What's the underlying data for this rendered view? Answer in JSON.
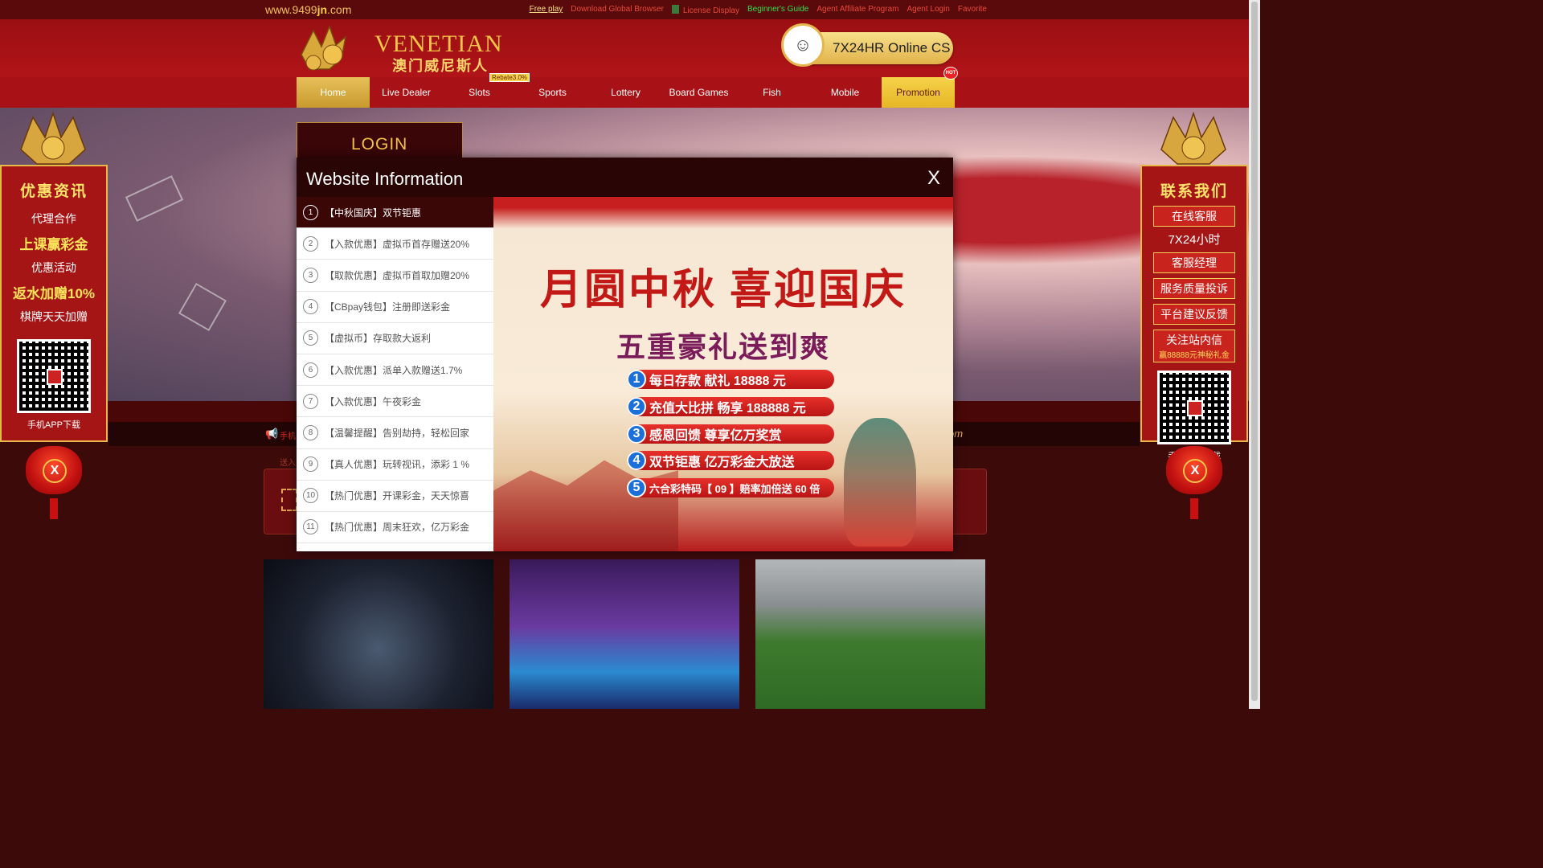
{
  "site": {
    "url_prefix": "www.9499",
    "url_bold": "jn",
    "url_suffix": ".com"
  },
  "top_links": [
    {
      "label": "Free play",
      "color": "#f6e38a"
    },
    {
      "label": "Download Global Browser",
      "color": "#e84a3a"
    },
    {
      "label": "License Display",
      "color": "#e84a3a"
    },
    {
      "label": "Beginner's Guide",
      "color": "#2ee04a"
    },
    {
      "label": "Agent Affiliate Program",
      "color": "#e84a3a"
    },
    {
      "label": "Agent Login",
      "color": "#e84a3a"
    },
    {
      "label": "Favorite",
      "color": "#e84a3a"
    }
  ],
  "logo": {
    "name": "VENETIAN",
    "subtitle": "澳门威尼斯人"
  },
  "cs": {
    "label": "7X24HR Online CS"
  },
  "nav": {
    "items": [
      "Home",
      "Live Dealer",
      "Slots",
      "Sports",
      "Lottery",
      "Board Games",
      "Fish",
      "Mobile",
      "Promotion"
    ],
    "rebate_tag": "Rebate3.0%",
    "hot_tag": "HOT"
  },
  "login": {
    "title": "LOGIN"
  },
  "marquee": {
    "fragment": "手机",
    "domain_fragment": "om",
    "sub_fragment": "送入"
  },
  "modal": {
    "title": "Website Information",
    "close": "X",
    "items": [
      {
        "num": "1",
        "text": "【中秋国庆】双节钜惠"
      },
      {
        "num": "2",
        "text": "【入款优惠】虚拟币首存赠送20%"
      },
      {
        "num": "3",
        "text": "【取款优惠】虚拟币首取加赠20%"
      },
      {
        "num": "4",
        "text": "【CBpay钱包】注册即送彩金"
      },
      {
        "num": "5",
        "text": "【虚拟币】存取款大返利"
      },
      {
        "num": "6",
        "text": "【入款优惠】派单入款赠送1.7%"
      },
      {
        "num": "7",
        "text": "【入款优惠】午夜彩金"
      },
      {
        "num": "8",
        "text": "【温馨提醒】告别劫持，轻松回家"
      },
      {
        "num": "9",
        "text": "【真人优惠】玩转视讯，添彩 1 %"
      },
      {
        "num": "10",
        "text": "【热门优惠】开课彩金，天天惊喜"
      },
      {
        "num": "11",
        "text": "【热门优惠】周末狂欢，亿万彩金"
      }
    ],
    "active_index": 0
  },
  "poster": {
    "headline": "月圆中秋 喜迎国庆",
    "subheadline": "五重豪礼送到爽",
    "lines": [
      {
        "num": "1",
        "text": "每日存款 献礼 18888 元"
      },
      {
        "num": "2",
        "text": "充值大比拼 畅享 188888 元"
      },
      {
        "num": "3",
        "text": "感恩回馈 尊享亿万奖赏"
      },
      {
        "num": "4",
        "text": "双节钜惠 亿万彩金大放送"
      },
      {
        "num": "5",
        "text": "六合彩特码【 09 】赔率加倍送 60 倍"
      }
    ]
  },
  "side_left": {
    "title": "优惠资讯",
    "lines": [
      "代理合作",
      "上课赢彩金",
      "优惠活动",
      "返水加赠10%",
      "棋牌天天加赠"
    ],
    "qr_caption": "手机APP下载",
    "close": "X"
  },
  "side_right": {
    "title": "联系我们",
    "btn1": "在线客服",
    "hours": "7X24小时",
    "btn2": "客服经理",
    "btn3": "服务质量投诉",
    "btn4": "平台建议反馈",
    "btn5": "关注站内信",
    "btn5_small": "赢88888元神秘礼金",
    "qr_caption": "手机APP下载",
    "close": "X"
  }
}
